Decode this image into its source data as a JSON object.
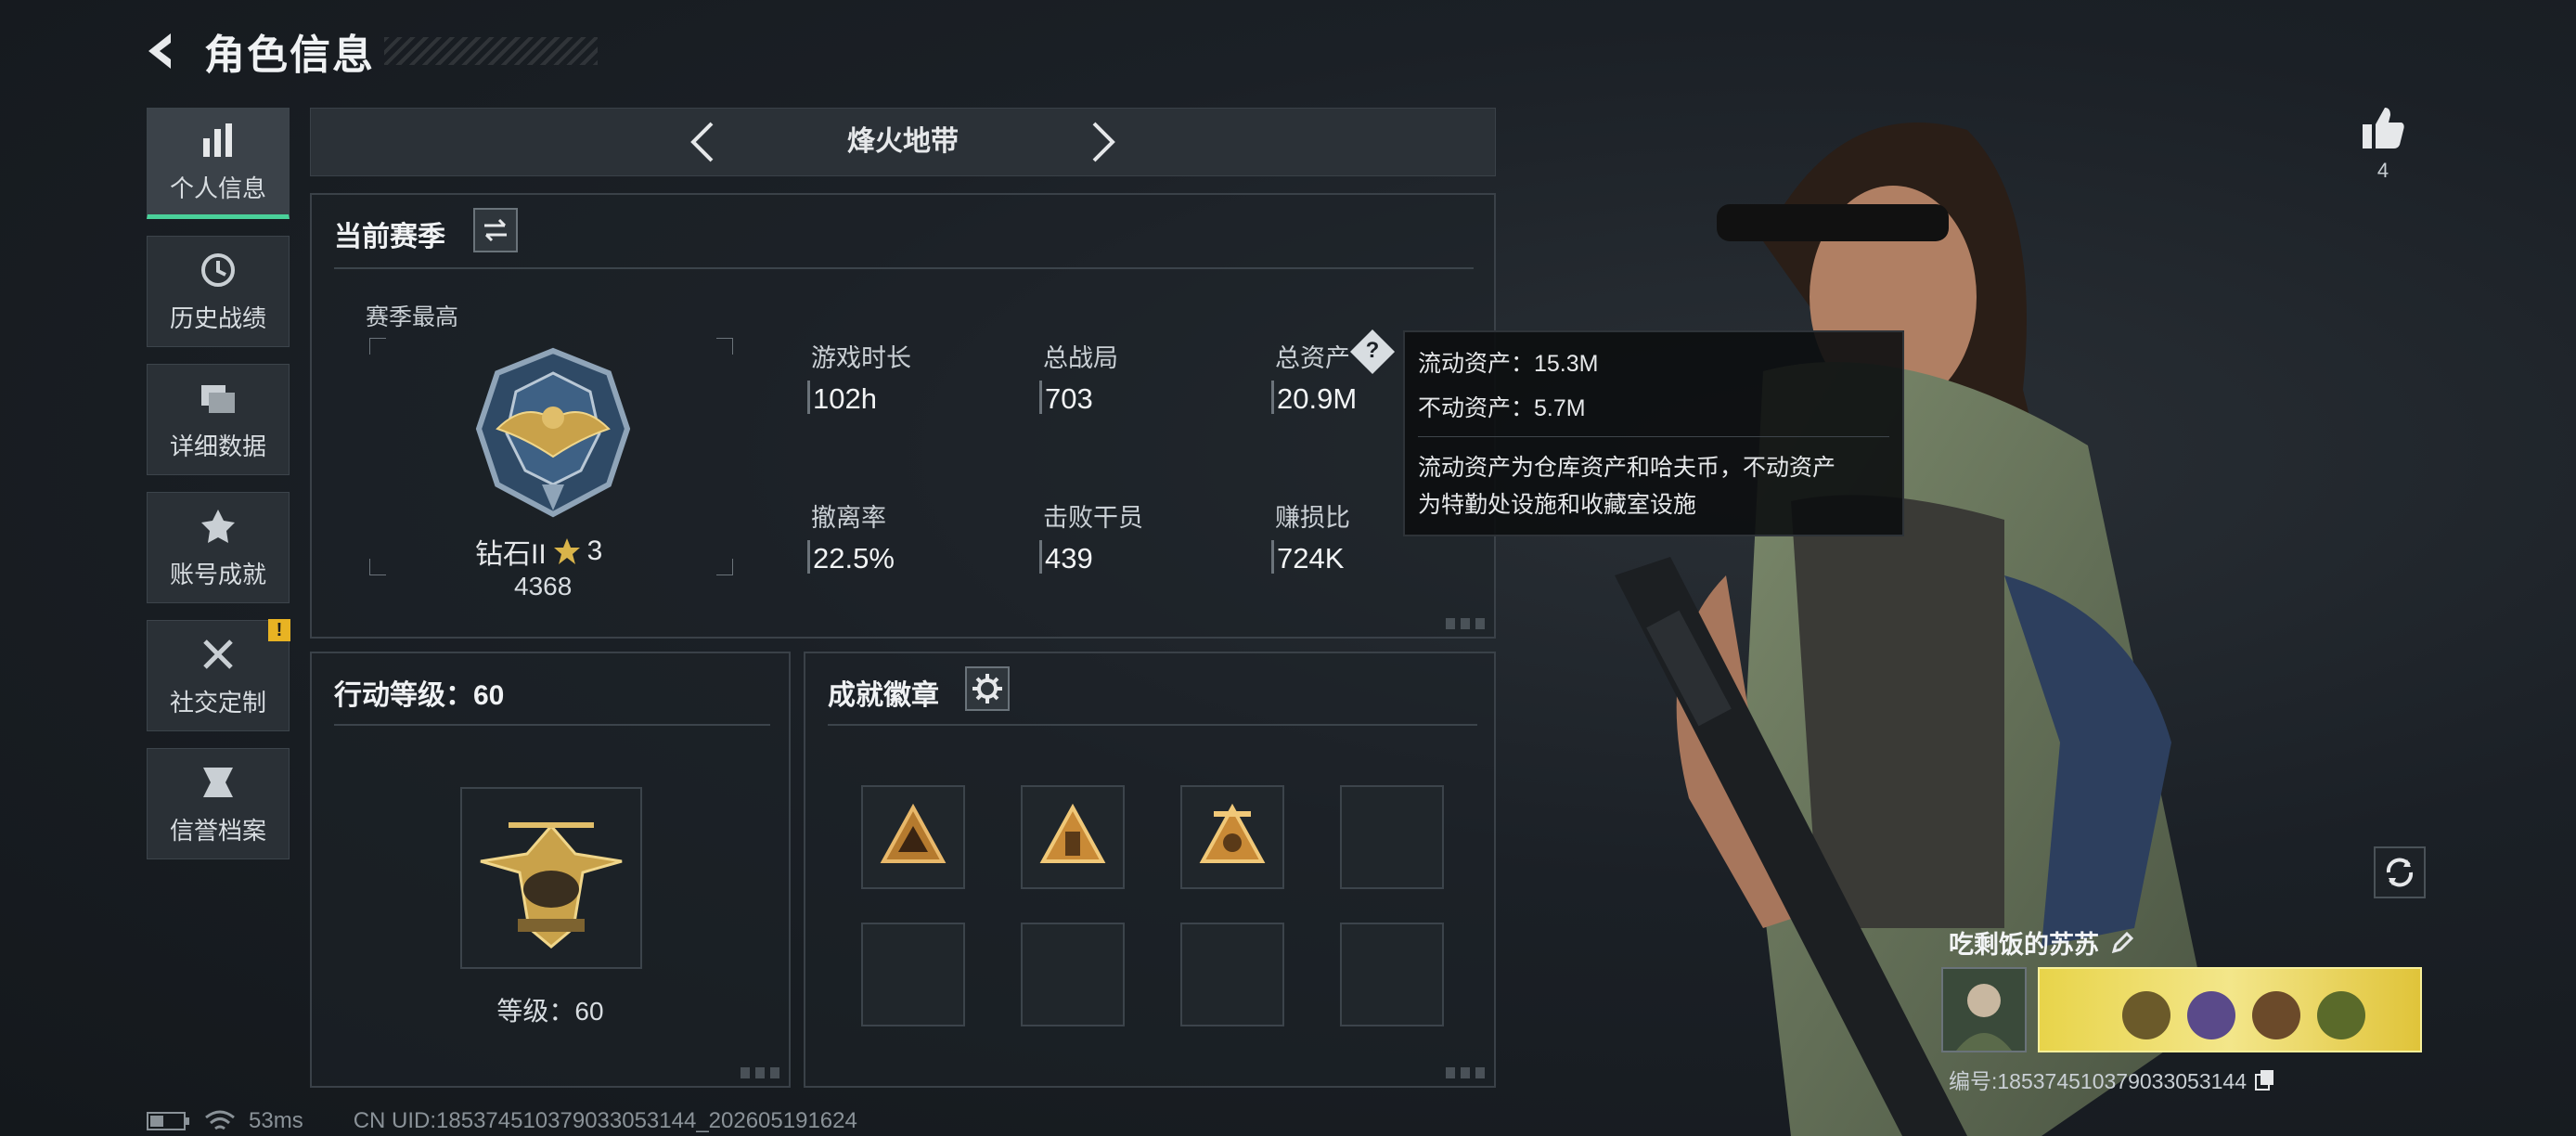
{
  "header": {
    "title": "角色信息"
  },
  "sidebar": {
    "items": [
      {
        "label": "个人信息",
        "icon": "bar-chart-icon",
        "active": true
      },
      {
        "label": "历史战绩",
        "icon": "history-clock-icon"
      },
      {
        "label": "详细数据",
        "icon": "data-folder-icon"
      },
      {
        "label": "账号成就",
        "icon": "achievement-icon"
      },
      {
        "label": "社交定制",
        "icon": "tools-icon",
        "badge": "!"
      },
      {
        "label": "信誉档案",
        "icon": "credit-shield-icon"
      }
    ]
  },
  "mode_selector": {
    "title": "烽火地带"
  },
  "season": {
    "title": "当前赛季",
    "best_label": "赛季最高",
    "rank_name": "钻石II",
    "rank_stars": "3",
    "rank_score": "4368",
    "stats": [
      {
        "label": "游戏时长",
        "value": "102h"
      },
      {
        "label": "总战局",
        "value": "703"
      },
      {
        "label": "总资产",
        "value": "20.9M"
      },
      {
        "label": "撤离率",
        "value": "22.5%"
      },
      {
        "label": "击败干员",
        "value": "439"
      },
      {
        "label": "赚损比",
        "value": "724K"
      }
    ],
    "help_icon": "?"
  },
  "tooltip": {
    "liquid": "流动资产：15.3M",
    "fixed": "不动资产：5.7M",
    "desc_line1": "流动资产为仓库资产和哈夫币，不动资产",
    "desc_line2": "为特勤处设施和收藏室设施"
  },
  "level": {
    "title": "行动等级：60",
    "caption": "等级：60"
  },
  "badges": {
    "title": "成就徽章"
  },
  "player": {
    "likes": "4",
    "name": "吃剩饭的苏苏",
    "id_text": "编号:1853745103790330531​44"
  },
  "status_bar": {
    "ping": "53ms",
    "uid": "CN UID:18537451037903305314​4_202605191624"
  },
  "colors": {
    "accent": "#4ad19a",
    "warning": "#e8b323",
    "gold": "#c9a24a"
  }
}
